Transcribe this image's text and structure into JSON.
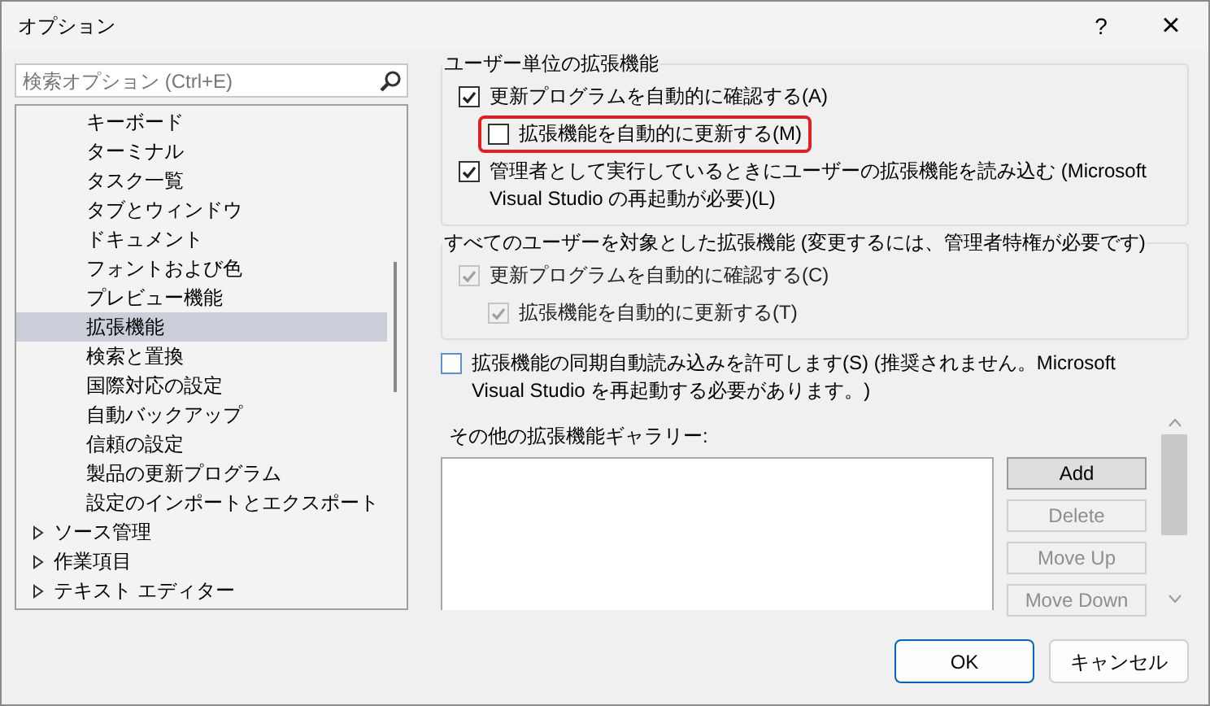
{
  "window": {
    "title": "オプション",
    "help": "?",
    "close": "×"
  },
  "search": {
    "placeholder": "検索オプション (Ctrl+E)"
  },
  "tree": {
    "items": [
      {
        "children": [
          {
            "label": "キーボード",
            "selected": false
          },
          {
            "label": "ターミナル",
            "selected": false
          },
          {
            "label": "タスク一覧",
            "selected": false
          },
          {
            "label": "タブとウィンドウ",
            "selected": false
          },
          {
            "label": "ドキュメント",
            "selected": false
          },
          {
            "label": "フォントおよび色",
            "selected": false
          },
          {
            "label": "プレビュー機能",
            "selected": false
          },
          {
            "label": "拡張機能",
            "selected": true
          },
          {
            "label": "検索と置換",
            "selected": false
          },
          {
            "label": "国際対応の設定",
            "selected": false
          },
          {
            "label": "自動バックアップ",
            "selected": false
          },
          {
            "label": "信頼の設定",
            "selected": false
          },
          {
            "label": "製品の更新プログラム",
            "selected": false
          },
          {
            "label": "設定のインポートとエクスポート",
            "selected": false
          }
        ]
      },
      {
        "label": "ソース管理",
        "selected": false,
        "expanded": false
      },
      {
        "label": "作業項目",
        "selected": false,
        "expanded": false
      },
      {
        "label": "テキスト エディター",
        "selected": false,
        "expanded": false
      }
    ]
  },
  "groups": [
    {
      "title": "ユーザー単位の拡張機能",
      "options": [
        {
          "label": "更新プログラムを自動的に確認する(A)",
          "checked": true,
          "disabled": false,
          "highlighted": false,
          "indented": false
        },
        {
          "label": "拡張機能を自動的に更新する(M)",
          "checked": false,
          "disabled": false,
          "highlighted": true,
          "indented": true
        },
        {
          "label": "管理者として実行しているときにユーザーの拡張機能を読み込む (Microsoft Visual Studio の再起動が必要)(L)",
          "checked": true,
          "disabled": false,
          "highlighted": false,
          "indented": false
        }
      ]
    },
    {
      "title": "すべてのユーザーを対象とした拡張機能 (変更するには、管理者特権が必要です)",
      "options": [
        {
          "label": "更新プログラムを自動的に確認する(C)",
          "checked": true,
          "disabled": true,
          "highlighted": false,
          "indented": false
        },
        {
          "label": "拡張機能を自動的に更新する(T)",
          "checked": true,
          "disabled": true,
          "highlighted": false,
          "indented": true
        }
      ]
    }
  ],
  "sync_option": {
    "label": "拡張機能の同期自動読み込みを許可します(S) (推奨されません。Microsoft Visual Studio を再起動する必要があります。)",
    "checked": false
  },
  "gallery": {
    "label": "その他の拡張機能ギャラリー:",
    "buttons": [
      {
        "label": "Add",
        "disabled": false
      },
      {
        "label": "Delete",
        "disabled": true
      },
      {
        "label": "Move Up",
        "disabled": true
      },
      {
        "label": "Move Down",
        "disabled": true
      }
    ]
  },
  "footer_buttons": [
    {
      "label": "OK",
      "default": true
    },
    {
      "label": "キャンセル",
      "default": false
    }
  ]
}
